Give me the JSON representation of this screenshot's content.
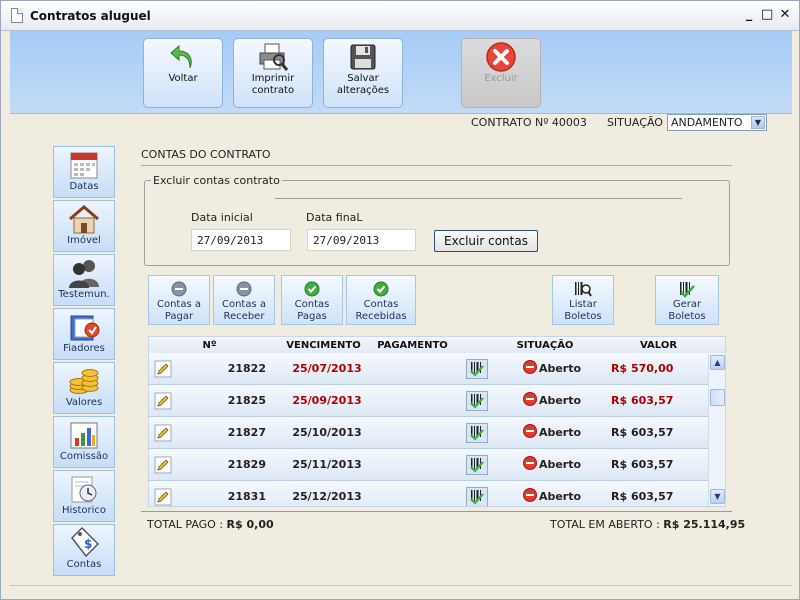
{
  "window": {
    "title": "Contratos aluguel",
    "controls": [
      "_",
      "□",
      "✕"
    ]
  },
  "toolbar": {
    "voltar": "Voltar",
    "imprimir": [
      "Imprimir",
      "contrato"
    ],
    "salvar": [
      "Salvar",
      "alterações"
    ],
    "excluir": "Excluir"
  },
  "contract": {
    "number_label": "CONTRATO Nº 40003",
    "situacao_label": "SITUAÇÃO",
    "situacao_value": "ANDAMENTO"
  },
  "sidebar": {
    "items": [
      "Datas",
      "Imóvel",
      "Testemun.",
      "Fiadores",
      "Valores",
      "Comissão",
      "Historico",
      "Contas"
    ]
  },
  "section": {
    "title": "CONTAS DO CONTRATO",
    "legend": "Excluir contas contrato"
  },
  "filters": {
    "data_inicial_label": "Data inicial",
    "data_inicial_value": "27/09/2013",
    "data_final_label": "Data finaL",
    "data_final_value": "27/09/2013",
    "excluir_button": "Excluir contas"
  },
  "filter_buttons": {
    "pagar": [
      "Contas a",
      "Pagar"
    ],
    "receber": [
      "Contas a",
      "Receber"
    ],
    "pagas": [
      "Contas",
      "Pagas"
    ],
    "recebidas": [
      "Contas",
      "Recebidas"
    ],
    "listar": [
      "Listar",
      "Boletos"
    ],
    "gerar": [
      "Gerar",
      "Boletos"
    ]
  },
  "table": {
    "headers": [
      "Nº",
      "VENCIMENTO",
      "PAGAMENTO",
      "SITUAÇÃO",
      "VALOR"
    ],
    "rows": [
      {
        "num": "21822",
        "venc": "25/07/2013",
        "pag": "",
        "sit": "Aberto",
        "valor": "R$ 570,00",
        "overdue": true
      },
      {
        "num": "21825",
        "venc": "25/09/2013",
        "pag": "",
        "sit": "Aberto",
        "valor": "R$ 603,57",
        "overdue": true
      },
      {
        "num": "21827",
        "venc": "25/10/2013",
        "pag": "",
        "sit": "Aberto",
        "valor": "R$ 603,57",
        "overdue": false
      },
      {
        "num": "21829",
        "venc": "25/11/2013",
        "pag": "",
        "sit": "Aberto",
        "valor": "R$ 603,57",
        "overdue": false
      },
      {
        "num": "21831",
        "venc": "25/12/2013",
        "pag": "",
        "sit": "Aberto",
        "valor": "R$ 603,57",
        "overdue": false
      }
    ]
  },
  "totals": {
    "pago_label": "TOTAL PAGO  :",
    "pago_value": "R$ 0,00",
    "aberto_label": "TOTAL EM ABERTO  :",
    "aberto_value": "R$ 25.114,95"
  },
  "colors": {
    "overdue": "#b00000",
    "toolbar": "#a6cbf5",
    "background": "#f0ece0"
  }
}
